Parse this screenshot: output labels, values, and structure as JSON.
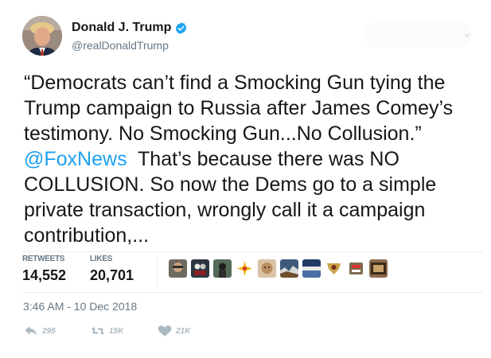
{
  "user": {
    "display_name": "Donald J. Trump",
    "handle": "@realDonaldTrump",
    "verified": true,
    "avatar": "profile-photo"
  },
  "tweet": {
    "text_before_mention": "“Democrats can’t find a Smocking Gun tying the Trump campaign to Russia after James Comey’s testimony. No Smocking Gun...No Collusion.” ",
    "mention": "@FoxNews",
    "text_after_mention": "  That’s because there was NO COLLUSION. So now the Dems go to a simple private transaction, wrongly call it a campaign contribution,..."
  },
  "stats": {
    "retweets_label": "RETWEETS",
    "retweets_value": "14,552",
    "likes_label": "LIKES",
    "likes_value": "20,701"
  },
  "likers": [
    "liker-avatar-1",
    "liker-avatar-2",
    "liker-avatar-3",
    "liker-avatar-4",
    "liker-avatar-5",
    "liker-avatar-6",
    "liker-avatar-7",
    "liker-avatar-8",
    "liker-avatar-9",
    "liker-avatar-10"
  ],
  "timestamp": "3:46 AM - 10 Dec 2018",
  "actions": {
    "reply_count": "295",
    "retweet_count": "15K",
    "like_count": "21K"
  },
  "colors": {
    "link": "#1da1f2",
    "verified_badge": "#1da1f2",
    "secondary_text": "#657786",
    "action_icon": "#aab8c2",
    "divider": "#e6ecf0"
  }
}
